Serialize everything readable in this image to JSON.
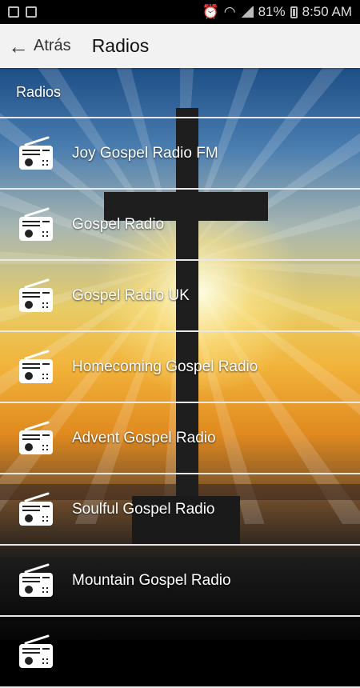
{
  "statusbar": {
    "battery": "81%",
    "time": "8:50 AM"
  },
  "toolbar": {
    "back_label": "Atrás",
    "title": "Radios"
  },
  "list": {
    "section_header": "Radios",
    "items": [
      {
        "label": "Joy Gospel Radio FM",
        "icon": "radio-icon"
      },
      {
        "label": "Gospel Radio",
        "icon": "radio-icon"
      },
      {
        "label": "Gospel Radio UK",
        "icon": "radio-icon"
      },
      {
        "label": "Homecoming Gospel Radio",
        "icon": "radio-icon"
      },
      {
        "label": "Advent Gospel Radio",
        "icon": "radio-icon"
      },
      {
        "label": "Soulful Gospel Radio",
        "icon": "radio-icon"
      },
      {
        "label": "Mountain Gospel Radio",
        "icon": "radio-icon"
      },
      {
        "label": "",
        "icon": "radio-icon"
      }
    ]
  }
}
